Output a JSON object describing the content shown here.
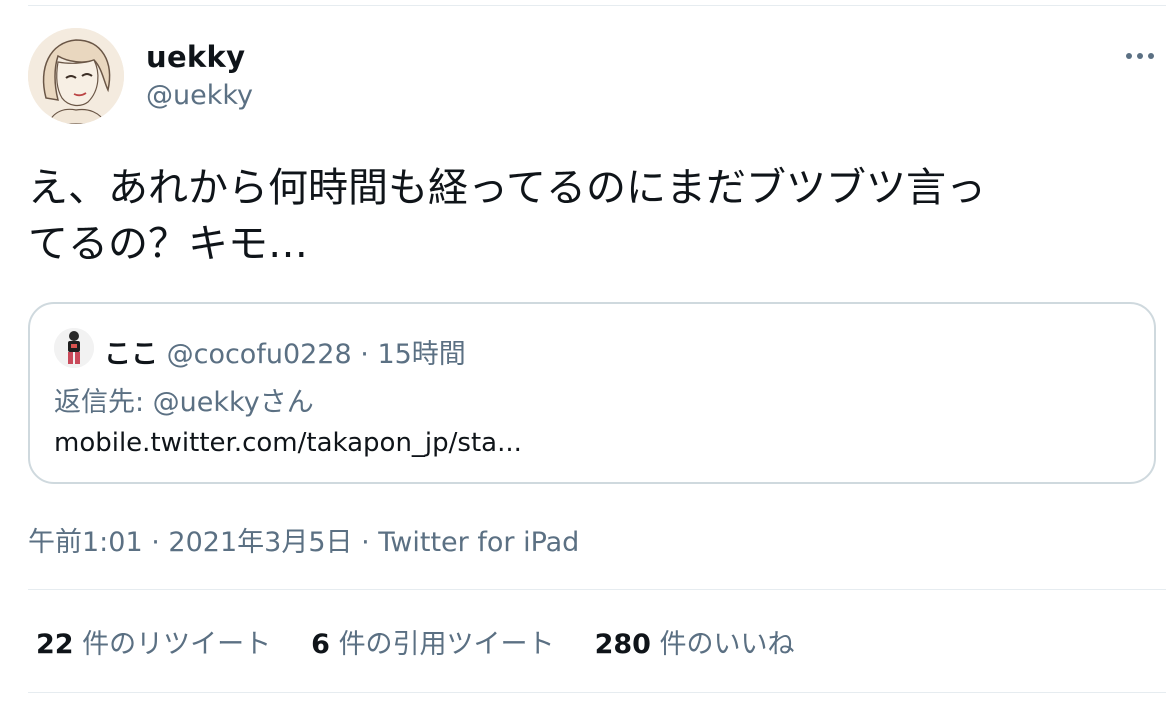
{
  "author": {
    "display_name": "uekky",
    "handle": "@uekky"
  },
  "tweet": {
    "text": "え、あれから何時間も経ってるのにまだブツブツ言っ\nてるの？キモ…"
  },
  "quote": {
    "name": "ここ",
    "handle": "@cocofu0228",
    "separator": "·",
    "time": "15時間",
    "reply_to": "返信先: @uekkyさん",
    "link": "mobile.twitter.com/takapon_jp/sta..."
  },
  "meta": {
    "time": "午前1:01",
    "separator1": "·",
    "date": "2021年3月5日",
    "separator2": "·",
    "source": "Twitter for iPad"
  },
  "stats": {
    "retweets_count": "22",
    "retweets_label": "件のリツイート",
    "quotes_count": "6",
    "quotes_label": "件の引用ツイート",
    "likes_count": "280",
    "likes_label": "件のいいね"
  },
  "colors": {
    "text_primary": "#0f1419",
    "text_secondary": "#5b7083",
    "border": "#cfd9de",
    "divider": "#e6ecf0"
  },
  "icons": {
    "more": "more-horizontal-icon"
  }
}
